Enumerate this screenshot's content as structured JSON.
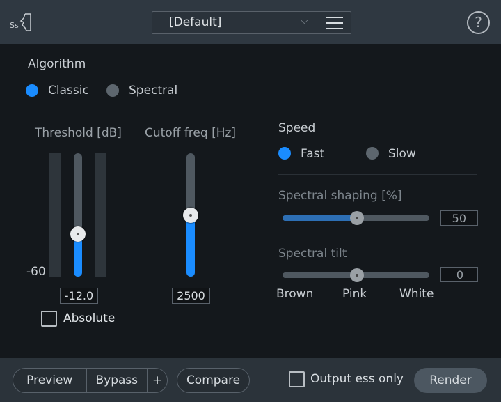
{
  "header": {
    "logo": "Ss",
    "preset": "[Default]",
    "menu_icon": "hamburger-icon",
    "help_icon": "question-icon"
  },
  "algorithm": {
    "label": "Algorithm",
    "options": [
      "Classic",
      "Spectral"
    ],
    "selected": "Classic"
  },
  "threshold": {
    "label": "Threshold [dB]",
    "scale_min": "-60",
    "value": "-12.0",
    "slider_fraction": 0.35
  },
  "absolute": {
    "label": "Absolute",
    "checked": false
  },
  "cutoff": {
    "label": "Cutoff freq [Hz]",
    "value": "2500",
    "slider_fraction": 0.5
  },
  "speed": {
    "label": "Speed",
    "options": [
      "Fast",
      "Slow"
    ],
    "selected": "Fast"
  },
  "spectral_shaping": {
    "label": "Spectral shaping [%]",
    "value": "50",
    "fraction": 0.5
  },
  "spectral_tilt": {
    "label": "Spectral tilt",
    "value": "0",
    "fraction": 0.5,
    "ticks": [
      "Brown",
      "Pink",
      "White"
    ]
  },
  "footer": {
    "preview": "Preview",
    "bypass": "Bypass",
    "plus": "+",
    "compare": "Compare",
    "output_only": "Output ess only",
    "render": "Render"
  },
  "colors": {
    "accent": "#1a8cff",
    "header": "#2f3841",
    "background": "#14181c"
  }
}
